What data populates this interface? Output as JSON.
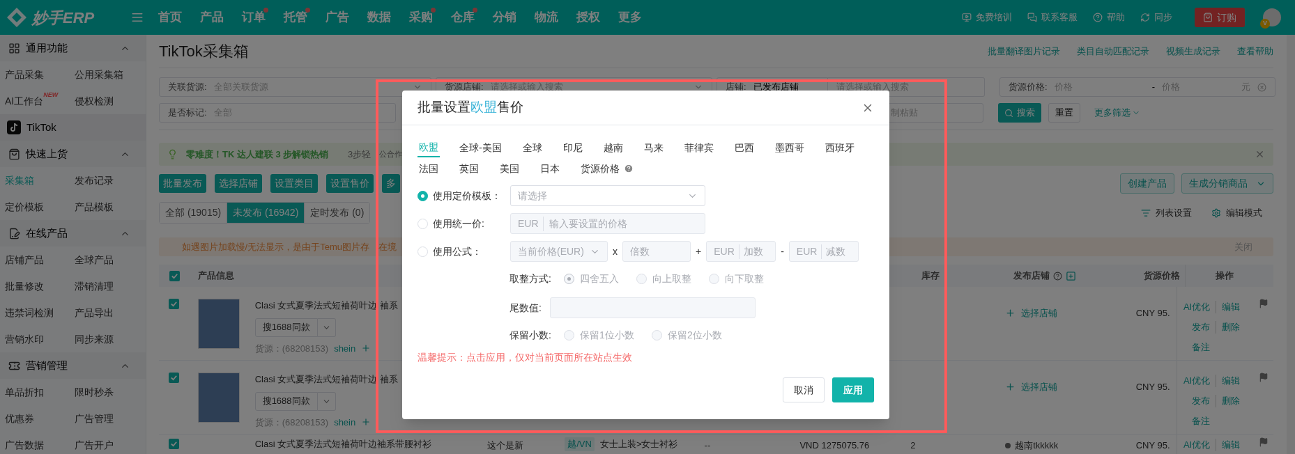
{
  "topbar": {
    "logo": "妙手ERP",
    "nav": [
      {
        "label": "首页",
        "dot": false
      },
      {
        "label": "产品",
        "dot": false
      },
      {
        "label": "订单",
        "dot": true
      },
      {
        "label": "托管",
        "dot": true
      },
      {
        "label": "广告",
        "dot": false
      },
      {
        "label": "数据",
        "dot": false
      },
      {
        "label": "采购",
        "dot": true
      },
      {
        "label": "仓库",
        "dot": true
      },
      {
        "label": "分销",
        "dot": false
      },
      {
        "label": "物流",
        "dot": false
      },
      {
        "label": "授权",
        "dot": false
      },
      {
        "label": "更多",
        "dot": false
      }
    ],
    "tools": [
      "免费培训",
      "联系客服",
      "帮助",
      "同步"
    ],
    "order_button": "订购",
    "avatar_badge": "V"
  },
  "sidebar": [
    {
      "kind": "section",
      "title": "通用功能",
      "expanded": true,
      "items": [
        {
          "label": "产品采集",
          "selected": false
        },
        {
          "label": "公用采集箱",
          "selected": false
        },
        {
          "label": "AI工作台",
          "selected": false,
          "badge": "NEW"
        },
        {
          "label": "侵权检测",
          "selected": false
        }
      ]
    },
    {
      "kind": "platform",
      "title": "TikTok"
    },
    {
      "kind": "section",
      "title": "快速上货",
      "expanded": true,
      "items": [
        {
          "label": "采集箱",
          "selected": true
        },
        {
          "label": "发布记录",
          "selected": false
        },
        {
          "label": "定价模板",
          "selected": false
        },
        {
          "label": "产品模板",
          "selected": false
        }
      ]
    },
    {
      "kind": "section",
      "title": "在线产品",
      "expanded": true,
      "items": [
        {
          "label": "店铺产品",
          "selected": false
        },
        {
          "label": "全球产品",
          "selected": false
        },
        {
          "label": "批量修改",
          "selected": false
        },
        {
          "label": "滞销清理",
          "selected": false
        },
        {
          "label": "违禁词检测",
          "selected": false
        },
        {
          "label": "产品导出",
          "selected": false
        },
        {
          "label": "营销水印",
          "selected": false
        },
        {
          "label": "同步来源",
          "selected": false
        }
      ]
    },
    {
      "kind": "section",
      "title": "营销管理",
      "expanded": true,
      "items": [
        {
          "label": "单品折扣",
          "selected": false
        },
        {
          "label": "限时秒杀",
          "selected": false
        },
        {
          "label": "优惠券",
          "selected": false
        },
        {
          "label": "广告管理",
          "selected": false
        },
        {
          "label": "广告数据",
          "selected": false
        },
        {
          "label": "广告开户",
          "selected": false
        }
      ]
    }
  ],
  "page": {
    "title": "TikTok采集箱",
    "links": [
      "批量翻译图片记录",
      "类目自动匹配记录",
      "视频生成记录",
      "查看帮助"
    ]
  },
  "filters": {
    "source": {
      "label": "关联货源:",
      "placeholder": "全部关联货源"
    },
    "source_shop": {
      "label": "货源店铺:",
      "placeholder": "请选择或输入搜索"
    },
    "shop": {
      "label": "店铺:",
      "value": "已发布店铺",
      "search_placeholder": "请选择或输入搜索"
    },
    "price": {
      "label": "货源价格:",
      "min_placeholder": "价格",
      "separator": "-",
      "max_placeholder": "价格",
      "unit": "元"
    },
    "marked": {
      "label": "是否标记:",
      "value": "全部"
    },
    "paste_placeholder": "制粘贴",
    "search_button": "搜索",
    "reset_button": "重置",
    "more_filters": "更多筛选"
  },
  "banner": {
    "headline": "零难度！TK 达人建联 3 步解锁热销",
    "tail_start": "3步轻",
    "tail_end": "公合作"
  },
  "actions": {
    "buttons": [
      "批量发布",
      "选择店铺",
      "设置类目",
      "设置售价",
      "多"
    ],
    "right_buttons": [
      {
        "label": "创建产品",
        "kind": "plain"
      },
      {
        "label": "生成分销商品",
        "kind": "dropdown"
      }
    ]
  },
  "tabs": [
    {
      "label": "全部 (19015)",
      "selected": false
    },
    {
      "label": "未发布 (16942)",
      "selected": true
    },
    {
      "label": "定时发布 (0)",
      "selected": false
    }
  ],
  "view_tools": [
    "列表设置",
    "编辑模式"
  ],
  "notice": {
    "text_start": "如遇图片加载慢/无法显示，是由于Temu图片存",
    "text_end": "在境",
    "close": "关闭"
  },
  "table": {
    "all_checked": true,
    "columns": {
      "product": "产品信息",
      "stock": "库存",
      "shop": "发布店铺",
      "source_price": "货源价格",
      "actions": "操作"
    },
    "rows": [
      {
        "checked": true,
        "title": "Clasi 女式夏季法式短袖荷叶边",
        "title_end": "袖系",
        "search_button": "搜1688同款",
        "source": "货源：(68208153)",
        "source_site": "shein",
        "shop": {
          "kind": "pick",
          "label": "选择店铺"
        },
        "price": "CNY 95.",
        "actions": [
          "AI优化",
          "编辑",
          "发布",
          "删除",
          "备注"
        ]
      },
      {
        "checked": true,
        "title": "Clasi 女式夏季法式短袖荷叶边",
        "title_end": "袖系",
        "search_button": "搜1688同款",
        "source": "货源：(68208153)",
        "source_site": "shein",
        "shop": {
          "kind": "pick",
          "label": "选择店铺"
        },
        "price": "CNY 95.",
        "actions": [
          "AI优化",
          "编辑",
          "发布",
          "删除",
          "备注"
        ]
      },
      {
        "checked": true,
        "title": "Clasi 女式夏季法式短袖荷叶边袖系带腰衬衫",
        "remark": "这个是新",
        "site_tag": "越/VN",
        "category": "女士上装>女士衬衫",
        "column_4": "--",
        "price_local": "VND 1275075.76",
        "stock": "2",
        "shop": {
          "kind": "store",
          "label": "越南tkkkkk"
        },
        "price": "CNY 95.",
        "actions": [
          "AI优化",
          "编辑"
        ]
      }
    ]
  },
  "modal": {
    "title": {
      "before": "批量设置",
      "region": "欧盟",
      "after": "售价"
    },
    "tabs": [
      {
        "label": "欧盟",
        "selected": true
      },
      {
        "label": "全球-美国",
        "selected": false
      },
      {
        "label": "全球",
        "selected": false
      },
      {
        "label": "印尼",
        "selected": false
      },
      {
        "label": "越南",
        "selected": false
      },
      {
        "label": "马来",
        "selected": false
      },
      {
        "label": "菲律宾",
        "selected": false
      },
      {
        "label": "巴西",
        "selected": false
      },
      {
        "label": "墨西哥",
        "selected": false
      },
      {
        "label": "西班牙",
        "selected": false
      },
      {
        "label": "法国",
        "selected": false
      },
      {
        "label": "英国",
        "selected": false
      },
      {
        "label": "美国",
        "selected": false
      },
      {
        "label": "日本",
        "selected": false
      },
      {
        "label": "货源价格",
        "selected": false,
        "help": true
      }
    ],
    "options": [
      {
        "kind": "template",
        "label": "使用定价模板：",
        "selected": true,
        "placeholder": "请选择"
      },
      {
        "kind": "fixed",
        "label": "使用统一价:",
        "selected": false,
        "currency": "EUR",
        "placeholder": "输入要设置的价格"
      },
      {
        "kind": "formula",
        "label": "使用公式：",
        "selected": false,
        "base": "当前价格(EUR)",
        "multiply": "x",
        "factor_placeholder": "倍数",
        "plus": "+",
        "add_currency": "EUR",
        "add_placeholder": "加数",
        "minus": "-",
        "sub_currency": "EUR",
        "sub_placeholder": "减数"
      }
    ],
    "rounding": {
      "label": "取整方式:",
      "options": [
        {
          "label": "四舍五入",
          "selected": true
        },
        {
          "label": "向上取整",
          "selected": false
        },
        {
          "label": "向下取整",
          "selected": false
        }
      ]
    },
    "tail": {
      "label": "尾数值:"
    },
    "decimals": {
      "label": "保留小数:",
      "options": [
        {
          "label": "保留1位小数",
          "selected": false
        },
        {
          "label": "保留2位小数",
          "selected": false
        }
      ]
    },
    "warning": "温馨提示：点击应用，仅对当前页面所在站点生效",
    "cancel": "取消",
    "apply": "应用"
  }
}
